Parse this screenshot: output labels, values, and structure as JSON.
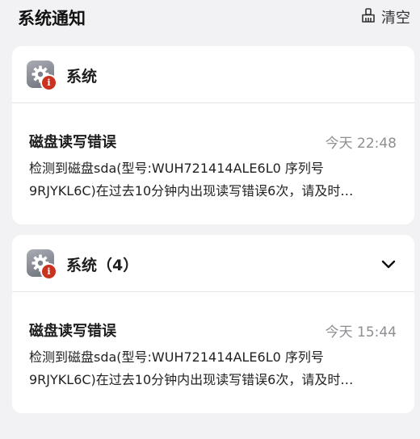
{
  "header": {
    "title": "系统通知",
    "clear_label": "清空",
    "clear_icon": "broom-icon"
  },
  "notifications": [
    {
      "app_name": "系统",
      "app_icon": "gear-icon",
      "badge_icon": "info-icon",
      "collapsible": false,
      "message": {
        "title": "磁盘读写错误",
        "time": "今天 22:48",
        "line1": "检测到磁盘sda(型号:WUH721414ALE6L0 序列号",
        "line2": "9RJYKL6C)在过去10分钟内出现读写错误6次，请及时…"
      }
    },
    {
      "app_name": "系统（4）",
      "app_icon": "gear-icon",
      "badge_icon": "info-icon",
      "collapsible": true,
      "message": {
        "title": "磁盘读写错误",
        "time": "今天 15:44",
        "line1": "检测到磁盘sda(型号:WUH721414ALE6L0 序列号",
        "line2": "9RJYKL6C)在过去10分钟内出现读写错误6次，请及时…"
      }
    }
  ],
  "colors": {
    "background": "#f2f2f4",
    "card": "#ffffff",
    "badge_red": "#c9331f",
    "time_gray": "#8e8e93"
  }
}
